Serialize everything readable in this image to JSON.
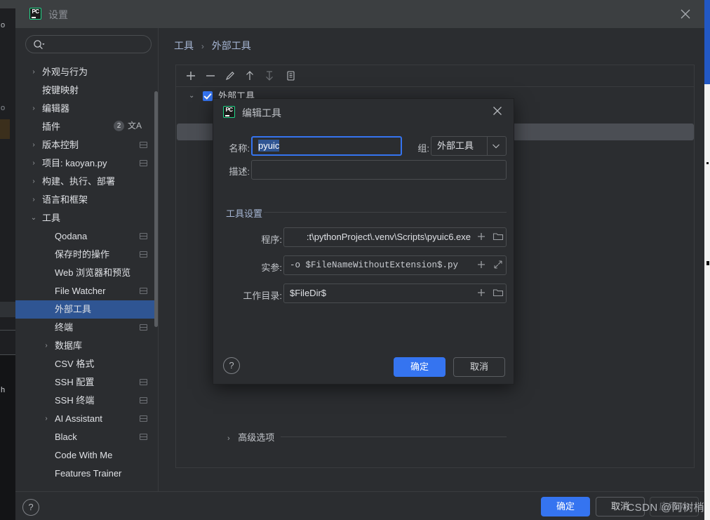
{
  "window": {
    "title": "设置",
    "logo_text": "PC",
    "close_icon": "close-icon"
  },
  "search": {
    "placeholder": "",
    "value": "",
    "icon": "search-icon"
  },
  "sidebar": {
    "items": [
      {
        "label": "外观与行为",
        "level": 0,
        "arrow": "›",
        "badge": "",
        "selected": false
      },
      {
        "label": "按键映射",
        "level": 0,
        "arrow": "",
        "badge": "",
        "selected": false
      },
      {
        "label": "编辑器",
        "level": 0,
        "arrow": "›",
        "badge": "",
        "selected": false
      },
      {
        "label": "插件",
        "level": 0,
        "arrow": "",
        "badge": "",
        "count": "2",
        "translate": true,
        "selected": false
      },
      {
        "label": "版本控制",
        "level": 0,
        "arrow": "›",
        "badge": "copy",
        "selected": false
      },
      {
        "label": "项目: kaoyan.py",
        "level": 0,
        "arrow": "›",
        "badge": "copy",
        "selected": false
      },
      {
        "label": "构建、执行、部署",
        "level": 0,
        "arrow": "›",
        "badge": "",
        "selected": false
      },
      {
        "label": "语言和框架",
        "level": 0,
        "arrow": "›",
        "badge": "",
        "selected": false
      },
      {
        "label": "工具",
        "level": 0,
        "arrow": "⌄",
        "badge": "",
        "selected": false
      },
      {
        "label": "Qodana",
        "level": 1,
        "arrow": "",
        "badge": "copy",
        "selected": false
      },
      {
        "label": "保存时的操作",
        "level": 1,
        "arrow": "",
        "badge": "copy",
        "selected": false
      },
      {
        "label": "Web 浏览器和预览",
        "level": 1,
        "arrow": "",
        "badge": "",
        "selected": false
      },
      {
        "label": "File Watcher",
        "level": 1,
        "arrow": "",
        "badge": "copy",
        "selected": false
      },
      {
        "label": "外部工具",
        "level": 1,
        "arrow": "",
        "badge": "",
        "selected": true
      },
      {
        "label": "终端",
        "level": 1,
        "arrow": "",
        "badge": "copy",
        "selected": false
      },
      {
        "label": "数据库",
        "level": 1,
        "arrow": "›",
        "badge": "",
        "selected": false
      },
      {
        "label": "CSV 格式",
        "level": 1,
        "arrow": "",
        "badge": "",
        "selected": false
      },
      {
        "label": "SSH 配置",
        "level": 1,
        "arrow": "",
        "badge": "copy",
        "selected": false
      },
      {
        "label": "SSH 终端",
        "level": 1,
        "arrow": "",
        "badge": "copy",
        "selected": false
      },
      {
        "label": "AI Assistant",
        "level": 1,
        "arrow": "›",
        "badge": "copy",
        "selected": false
      },
      {
        "label": "Black",
        "level": 1,
        "arrow": "",
        "badge": "copy",
        "selected": false
      },
      {
        "label": "Code With Me",
        "level": 1,
        "arrow": "",
        "badge": "",
        "selected": false
      },
      {
        "label": "Features Trainer",
        "level": 1,
        "arrow": "",
        "badge": "",
        "selected": false
      }
    ]
  },
  "content": {
    "breadcrumb": {
      "parent": "工具",
      "separator": "›",
      "current": "外部工具"
    },
    "nav": {
      "back_icon": "arrow-left-icon",
      "forward_icon": "arrow-right-icon"
    },
    "toolbar": [
      {
        "name": "add-tool-button",
        "icon": "plus-icon"
      },
      {
        "name": "remove-tool-button",
        "icon": "minus-icon"
      },
      {
        "name": "edit-tool-button",
        "icon": "pencil-icon"
      },
      {
        "name": "move-up-button",
        "icon": "arrow-up-icon"
      },
      {
        "name": "move-down-button",
        "icon": "arrow-down-icon"
      },
      {
        "name": "copy-tool-button",
        "icon": "copy-icon"
      }
    ],
    "tree": [
      {
        "label": "外部工具",
        "level": 0,
        "checked": true,
        "arrow": "⌄"
      },
      {
        "label": "",
        "level": 1,
        "checked": true,
        "arrow": ""
      },
      {
        "label": "",
        "level": 1,
        "checked": true,
        "arrow": ""
      }
    ]
  },
  "dialog": {
    "title": "编辑工具",
    "logo_text": "PC",
    "close_icon": "close-icon",
    "name_label": "名称:",
    "name_value": "pyuic",
    "group_label": "组:",
    "group_value": "外部工具",
    "desc_label": "描述:",
    "desc_value": "",
    "settings_group": "工具设置",
    "program_label": "程序:",
    "program_value": ":t\\pythonProject\\.venv\\Scripts\\pyuic6.exe",
    "args_label": "实参:",
    "args_value": "-o $FileNameWithoutExtension$.py",
    "workdir_label": "工作目录:",
    "workdir_value": "$FileDir$",
    "advanced_label": "高级选项",
    "advanced_arrow": "›",
    "help_label": "?",
    "ok_label": "确定",
    "cancel_label": "取消",
    "insert_macro_icon": "plus-icon",
    "browse_icon": "folder-icon",
    "expand_icon": "expand-icon"
  },
  "bottom": {
    "help_label": "?",
    "ok_label": "确定",
    "cancel_label": "取消",
    "apply_label": "应用(A)"
  },
  "watermark": "CSDN @阿树梢",
  "colors": {
    "accent_blue": "#3574F0",
    "selection_blue": "#2F5593",
    "window_bg": "#2B2D30",
    "titlebar_bg": "#3C3F41",
    "breadcrumb_blue": "#A6B6D4",
    "logo_green": "#21D789"
  }
}
